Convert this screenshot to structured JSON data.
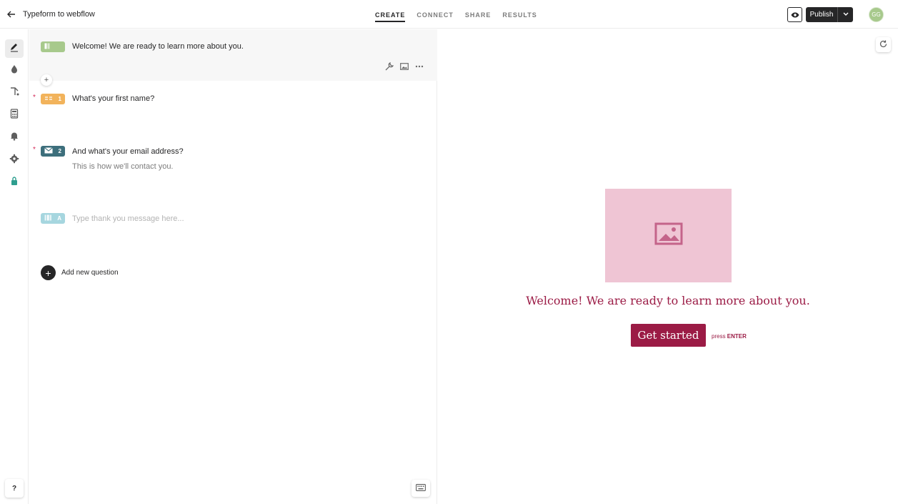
{
  "header": {
    "form_title": "Typeform to webflow",
    "tabs": [
      {
        "label": "CREATE",
        "active": true
      },
      {
        "label": "CONNECT",
        "active": false
      },
      {
        "label": "SHARE",
        "active": false
      },
      {
        "label": "RESULTS",
        "active": false
      }
    ],
    "publish_label": "Publish",
    "avatar_initials": "GG"
  },
  "editor": {
    "welcome": {
      "text": "Welcome! We are ready to learn more about you.",
      "color": "#a7c98c"
    },
    "questions": [
      {
        "number": "1",
        "text": "What's your first name?",
        "required": true,
        "required_mark": "*",
        "color": "#f2b35b",
        "icon": "short-text-icon"
      },
      {
        "number": "2",
        "text": "And what's your email address?",
        "subtext": "This is how we'll contact you.",
        "required": true,
        "required_mark": "*",
        "color": "#3d6f7c",
        "icon": "email-icon"
      }
    ],
    "thank_you": {
      "letter": "A",
      "placeholder": "Type thank you message here...",
      "color": "#a6d6df"
    },
    "add_question_label": "Add new question",
    "mini_add": "+"
  },
  "sidenav": {
    "help_label": "?"
  },
  "preview": {
    "welcome_text": "Welcome! We are ready to learn more about you.",
    "button_label": "Get started",
    "press_prefix": "press",
    "press_key": "ENTER",
    "accent": "#9b1b45",
    "image_bg": "#efc5d4"
  }
}
